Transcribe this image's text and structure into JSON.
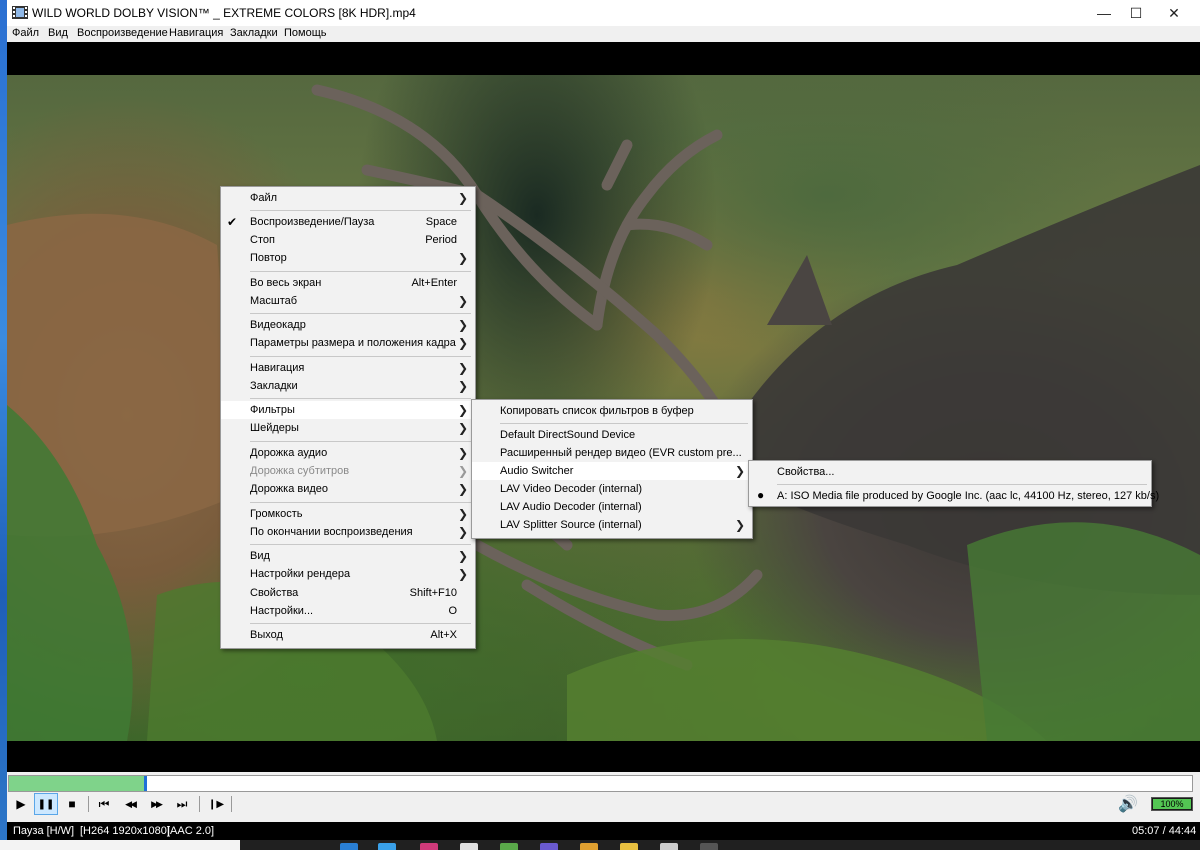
{
  "window": {
    "title": "WILD WORLD DOLBY VISION™ _ EXTREME COLORS [8K HDR].mp4",
    "minimize_glyph": "—",
    "maximize_glyph": "☐",
    "close_glyph": "✕"
  },
  "menubar": [
    "Файл",
    "Вид",
    "Воспроизведение",
    "Навигация",
    "Закладки",
    "Помощь"
  ],
  "context_menu": {
    "items": [
      {
        "label": "Файл",
        "submenu": true
      },
      {
        "label": "Воспроизведение/Пауза",
        "shortcut": "Space",
        "checked": true
      },
      {
        "label": "Стоп",
        "shortcut": "Period"
      },
      {
        "label": "Повтор",
        "submenu": true
      },
      {
        "label": "Во весь экран",
        "shortcut": "Alt+Enter"
      },
      {
        "label": "Масштаб",
        "submenu": true
      },
      {
        "label": "Видеокадр",
        "submenu": true
      },
      {
        "label": "Параметры размера и положения кадра",
        "submenu": true
      },
      {
        "label": "Навигация",
        "submenu": true
      },
      {
        "label": "Закладки",
        "submenu": true
      },
      {
        "label": "Фильтры",
        "submenu": true,
        "highlighted": true
      },
      {
        "label": "Шейдеры",
        "submenu": true
      },
      {
        "label": "Дорожка аудио",
        "submenu": true
      },
      {
        "label": "Дорожка субтитров",
        "submenu": true,
        "disabled": true
      },
      {
        "label": "Дорожка видео",
        "submenu": true
      },
      {
        "label": "Громкость",
        "submenu": true
      },
      {
        "label": "По окончании воспроизведения",
        "submenu": true
      },
      {
        "label": "Вид",
        "submenu": true
      },
      {
        "label": "Настройки рендера",
        "submenu": true
      },
      {
        "label": "Свойства",
        "shortcut": "Shift+F10"
      },
      {
        "label": "Настройки...",
        "shortcut": "O"
      },
      {
        "label": "Выход",
        "shortcut": "Alt+X"
      }
    ]
  },
  "filters_menu": {
    "items": [
      {
        "label": "Копировать список фильтров в буфер"
      },
      {
        "label": "Default DirectSound Device"
      },
      {
        "label": "Расширенный рендер видео (EVR custom pre..."
      },
      {
        "label": "Audio Switcher",
        "submenu": true,
        "highlighted": true
      },
      {
        "label": "LAV Video Decoder (internal)"
      },
      {
        "label": "LAV Audio Decoder (internal)"
      },
      {
        "label": "LAV Splitter Source (internal)",
        "submenu": true
      }
    ]
  },
  "audio_switcher_menu": {
    "items": [
      {
        "label": "Свойства..."
      },
      {
        "label": "A: ISO Media file produced by Google Inc. (aac lc, 44100 Hz, stereo, 127 kb/s)",
        "selected": true
      }
    ]
  },
  "playback": {
    "progress_fraction": 0.114,
    "volume_label": "100%",
    "volume_fraction": 1.0
  },
  "controls": {
    "play_glyph": "▶",
    "pause_glyph": "❚❚",
    "stop_glyph": "■",
    "prev_glyph": "⏮",
    "rewind_glyph": "◀◀",
    "forward_glyph": "▶▶",
    "next_glyph": "⏭",
    "frame_step_glyph": "❙▶",
    "volume_glyph": "🔊"
  },
  "status": {
    "state": "Пауза [H/W]",
    "video": "[H264 1920x1080]",
    "audio": "[AAC 2.0]",
    "time": "05:07 / 44:44"
  },
  "colors": {
    "seek_fill": "#7fd38a",
    "seek_handle": "#1f6fd8",
    "volume_fill": "#53c653"
  }
}
